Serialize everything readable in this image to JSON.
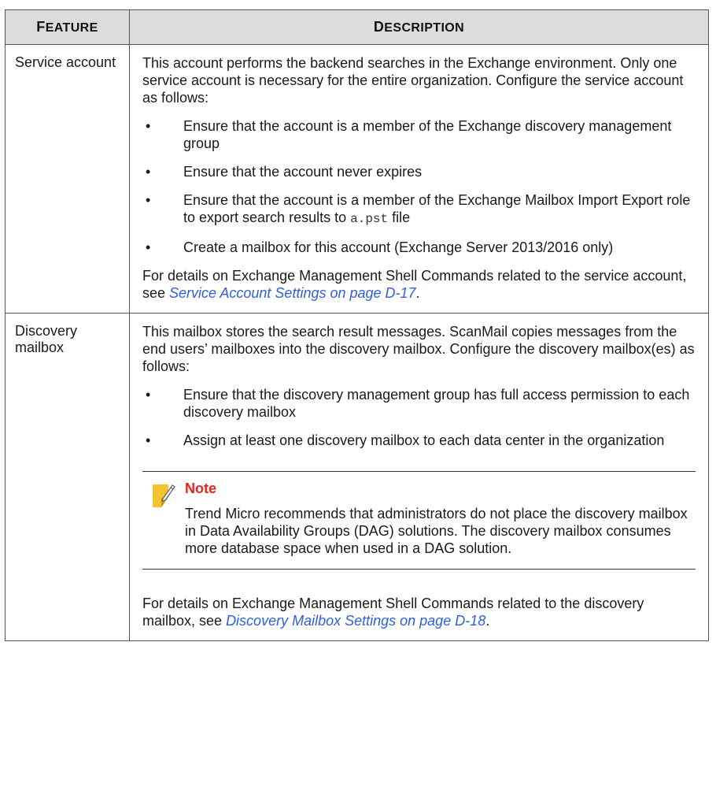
{
  "table": {
    "headers": {
      "feature": {
        "initial": "F",
        "rest": "EATURE"
      },
      "description": {
        "initial": "D",
        "rest": "ESCRIPTION"
      }
    },
    "rows": [
      {
        "feature": "Service account",
        "intro": "This account performs the backend searches in the Exchange environment. Only one service account is necessary for the entire organization. Configure the service account as follows:",
        "bullets": [
          "Ensure that the account is a member of the Exchange discovery management group",
          "Ensure that the account never expires",
          {
            "before": "Ensure that the account is a member of the Exchange Mailbox Import Export role to export search results to ",
            "code": "a.pst",
            "after": " file"
          },
          "Create a mailbox for this account (Exchange Server 2013/2016 only)"
        ],
        "footer": {
          "before": "For details on Exchange Management Shell Commands related to the service account, see ",
          "link": "Service Account Settings on page D-17",
          "after": "."
        }
      },
      {
        "feature": "Discovery mailbox",
        "intro": "This mailbox stores the search result messages. ScanMail copies messages from the end users’ mailboxes into the discovery mailbox. Configure the discovery mailbox(es) as follows:",
        "bullets": [
          "Ensure that the discovery management group has full access permission to each discovery mailbox",
          "Assign at least one discovery mailbox to each data center in the organization"
        ],
        "note": {
          "icon": "note-pencil-icon",
          "title": "Note",
          "body": "Trend Micro recommends that administrators do not place the discovery mailbox in Data Availability Groups (DAG) solutions. The discovery mailbox consumes more database space when used in a DAG solution."
        },
        "footer": {
          "before": "For details on Exchange Management Shell Commands related to the discovery mailbox, see ",
          "link": "Discovery Mailbox Settings on page D-18",
          "after": "."
        }
      }
    ]
  },
  "colors": {
    "header_bg": "#dcdcdc",
    "border": "#555555",
    "link": "#2e5fe0",
    "note_title": "#e8221c",
    "note_icon": "#f2c431"
  },
  "bullet_glyph": "•"
}
